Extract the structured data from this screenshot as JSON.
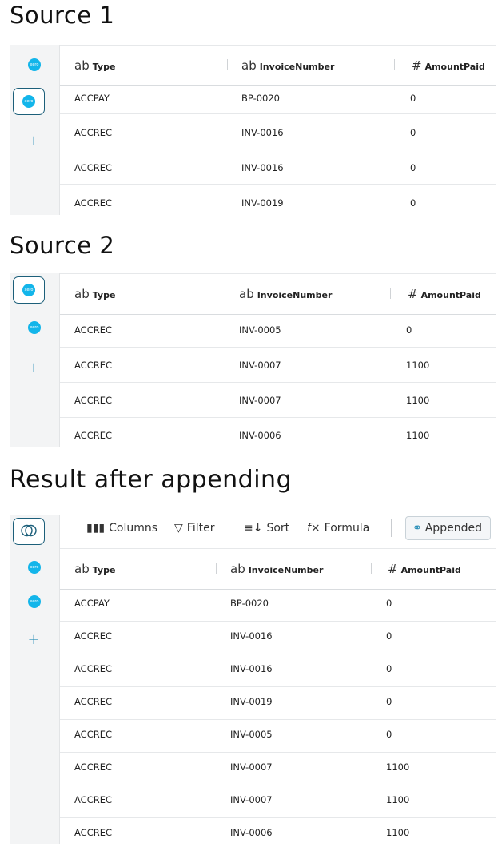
{
  "headings": {
    "source1": "Source 1",
    "source2": "Source 2",
    "result": "Result after appending"
  },
  "columns": {
    "type": {
      "icon": "ab",
      "label": "Type"
    },
    "invoice": {
      "icon": "ab",
      "label": "InvoiceNumber"
    },
    "amount": {
      "icon": "#",
      "label": "AmountPaid"
    }
  },
  "logo_text": "xero",
  "plus": "+",
  "source1": {
    "rows": [
      {
        "type": "ACCPAY",
        "invoice": "BP-0020",
        "amount": "0"
      },
      {
        "type": "ACCREC",
        "invoice": "INV-0016",
        "amount": "0"
      },
      {
        "type": "ACCREC",
        "invoice": "INV-0016",
        "amount": "0"
      },
      {
        "type": "ACCREC",
        "invoice": "INV-0019",
        "amount": "0"
      }
    ]
  },
  "source2": {
    "rows": [
      {
        "type": "ACCREC",
        "invoice": "INV-0005",
        "amount": "0"
      },
      {
        "type": "ACCREC",
        "invoice": "INV-0007",
        "amount": "1100"
      },
      {
        "type": "ACCREC",
        "invoice": "INV-0007",
        "amount": "1100"
      },
      {
        "type": "ACCREC",
        "invoice": "INV-0006",
        "amount": "1100"
      }
    ]
  },
  "result": {
    "toolbar": {
      "columns": "Columns",
      "filter": "Filter",
      "sort": "Sort",
      "formula": "Formula",
      "appended": "Appended"
    },
    "rows": [
      {
        "type": "ACCPAY",
        "invoice": "BP-0020",
        "amount": "0"
      },
      {
        "type": "ACCREC",
        "invoice": "INV-0016",
        "amount": "0"
      },
      {
        "type": "ACCREC",
        "invoice": "INV-0016",
        "amount": "0"
      },
      {
        "type": "ACCREC",
        "invoice": "INV-0019",
        "amount": "0"
      },
      {
        "type": "ACCREC",
        "invoice": "INV-0005",
        "amount": "0"
      },
      {
        "type": "ACCREC",
        "invoice": "INV-0007",
        "amount": "1100"
      },
      {
        "type": "ACCREC",
        "invoice": "INV-0007",
        "amount": "1100"
      },
      {
        "type": "ACCREC",
        "invoice": "INV-0006",
        "amount": "1100"
      }
    ]
  },
  "colors": {
    "accent": "#13b5ea",
    "frame": "#1c5f7a",
    "plus": "#2a8fb8"
  }
}
